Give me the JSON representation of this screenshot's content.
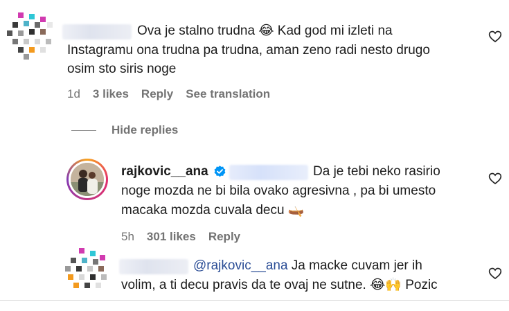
{
  "comment1": {
    "text_line1": "Ova je stalno trudna 😂 Kad god mi izleti na",
    "text_line2": "Instagramu ona trudna pa trudna, aman zeno radi nesto drugo",
    "text_line3": "osim sto siris noge",
    "time": "1d",
    "likes": "3 likes",
    "reply": "Reply",
    "translate": "See translation"
  },
  "hide_replies": "Hide replies",
  "reply1": {
    "username": "rajkovic__ana",
    "text_line1": "Da je tebi neko rasirio",
    "text_line2": "noge mozda ne bi bila ovako agresivna , pa bi umesto",
    "text_line3": "macaka mozda cuvala decu 🛶",
    "time": "5h",
    "likes": "301 likes",
    "reply": "Reply"
  },
  "reply2": {
    "mention": "@rajkovic__ana",
    "text_line1": " Ja macke cuvam jer ih",
    "text_line2": "volim, a ti decu pravis da te ovaj ne sutne. 😂🙌 Pozic"
  },
  "icons": {
    "heart": "heart-outline-icon",
    "verified": "verified-badge-icon"
  },
  "colors": {
    "accent_blue": "#0095f6",
    "mention": "#2c4e96",
    "meta_gray": "#737373"
  }
}
